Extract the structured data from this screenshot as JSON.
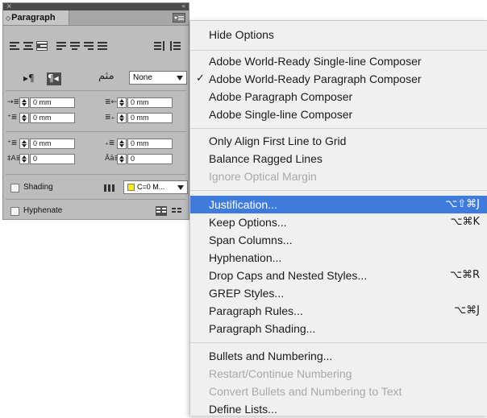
{
  "panel": {
    "close_glyph": "×",
    "collapse_glyph": "«",
    "tab_arrows": "◇",
    "tab_label": "Paragraph",
    "menu_button": "panel-menu-icon",
    "rtl_glyph": "مثم",
    "language_select": "None",
    "left_indent": "0 mm",
    "right_indent": "0 mm",
    "first_line_indent": "0 mm",
    "last_line_indent": "0 mm",
    "space_before": "0 mm",
    "space_after": "0 mm",
    "dropcap_lines": "0",
    "dropcap_chars": "0",
    "shading_label": "Shading",
    "shading_swatch": "C=0 M...",
    "hyphenate_label": "Hyphenate",
    "colors": {
      "panel_bg": "#bdbdbd",
      "selected": "#4d4d4d",
      "swatch": "#ffee00"
    }
  },
  "menu": {
    "highlight_color": "#3f7bdc",
    "items": [
      {
        "label": "Hide Options",
        "shortcut": "",
        "disabled": false,
        "checked": false
      },
      {
        "label": "Adobe World-Ready Single-line Composer",
        "shortcut": "",
        "disabled": false,
        "checked": false
      },
      {
        "label": "Adobe World-Ready Paragraph Composer",
        "shortcut": "",
        "disabled": false,
        "checked": true
      },
      {
        "label": "Adobe Paragraph Composer",
        "shortcut": "",
        "disabled": false,
        "checked": false
      },
      {
        "label": "Adobe Single-line Composer",
        "shortcut": "",
        "disabled": false,
        "checked": false
      },
      {
        "label": "Only Align First Line to Grid",
        "shortcut": "",
        "disabled": false,
        "checked": false
      },
      {
        "label": "Balance Ragged Lines",
        "shortcut": "",
        "disabled": false,
        "checked": false
      },
      {
        "label": "Ignore Optical Margin",
        "shortcut": "",
        "disabled": true,
        "checked": false
      },
      {
        "label": "Justification...",
        "shortcut": "⌥⇧⌘J",
        "disabled": false,
        "checked": false,
        "highlighted": true
      },
      {
        "label": "Keep Options...",
        "shortcut": "⌥⌘K",
        "disabled": false,
        "checked": false
      },
      {
        "label": "Span Columns...",
        "shortcut": "",
        "disabled": false,
        "checked": false
      },
      {
        "label": "Hyphenation...",
        "shortcut": "",
        "disabled": false,
        "checked": false
      },
      {
        "label": "Drop Caps and Nested Styles...",
        "shortcut": "⌥⌘R",
        "disabled": false,
        "checked": false
      },
      {
        "label": "GREP Styles...",
        "shortcut": "",
        "disabled": false,
        "checked": false
      },
      {
        "label": "Paragraph Rules...",
        "shortcut": "⌥⌘J",
        "disabled": false,
        "checked": false
      },
      {
        "label": "Paragraph Shading...",
        "shortcut": "",
        "disabled": false,
        "checked": false
      },
      {
        "label": "Bullets and Numbering...",
        "shortcut": "",
        "disabled": false,
        "checked": false
      },
      {
        "label": "Restart/Continue Numbering",
        "shortcut": "",
        "disabled": true,
        "checked": false
      },
      {
        "label": "Convert Bullets and Numbering to Text",
        "shortcut": "",
        "disabled": true,
        "checked": false
      },
      {
        "label": "Define Lists...",
        "shortcut": "",
        "disabled": false,
        "checked": false
      }
    ],
    "check_glyph": "✓"
  }
}
